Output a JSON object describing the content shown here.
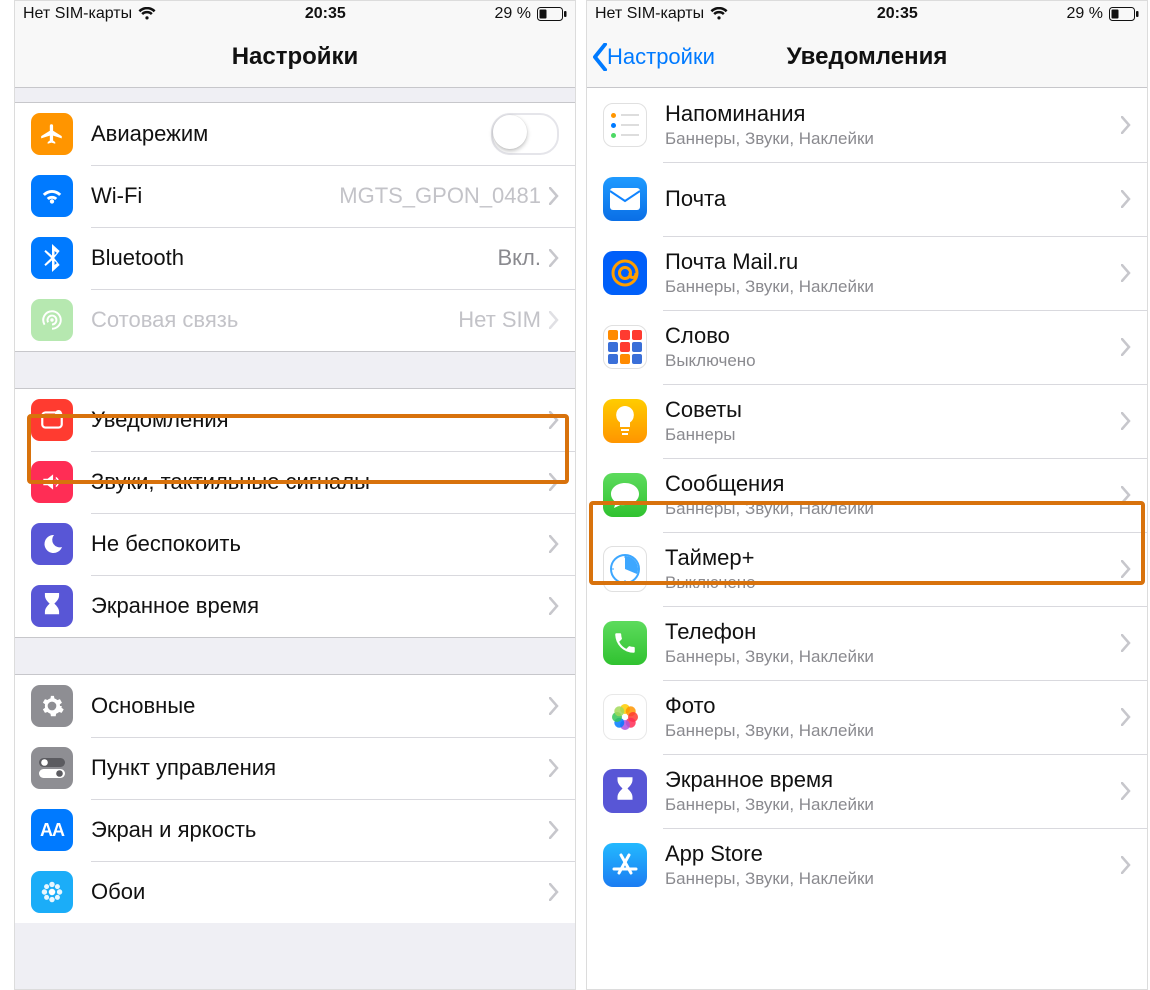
{
  "status": {
    "carrier": "Нет SIM-карты",
    "time": "20:35",
    "battery_pct": "29 %"
  },
  "left": {
    "title": "Настройки",
    "g1": {
      "airplane": "Авиарежим",
      "wifi": "Wi-Fi",
      "wifi_val": "MGTS_GPON_0481",
      "bt": "Bluetooth",
      "bt_val": "Вкл.",
      "cell": "Сотовая связь",
      "cell_val": "Нет SIM"
    },
    "g2": {
      "notif": "Уведомления",
      "sounds": "Звуки, тактильные сигналы",
      "dnd": "Не беспокоить",
      "screentime": "Экранное время"
    },
    "g3": {
      "general": "Основные",
      "control": "Пункт управления",
      "display": "Экран и яркость",
      "wallpaper": "Обои"
    }
  },
  "right": {
    "back": "Настройки",
    "title": "Уведомления",
    "apps": [
      {
        "name": "Напоминания",
        "sub": "Баннеры, Звуки, Наклейки",
        "icon": "reminders"
      },
      {
        "name": "Почта",
        "sub": "",
        "icon": "mail"
      },
      {
        "name": "Почта Mail.ru",
        "sub": "Баннеры, Звуки, Наклейки",
        "icon": "mailru"
      },
      {
        "name": "Слово",
        "sub": "Выключено",
        "icon": "slovo"
      },
      {
        "name": "Советы",
        "sub": "Баннеры",
        "icon": "tips"
      },
      {
        "name": "Сообщения",
        "sub": "Баннеры, Звуки, Наклейки",
        "icon": "messages"
      },
      {
        "name": "Таймер+",
        "sub": "Выключено",
        "icon": "timer"
      },
      {
        "name": "Телефон",
        "sub": "Баннеры, Звуки, Наклейки",
        "icon": "phone"
      },
      {
        "name": "Фото",
        "sub": "Баннеры, Звуки, Наклейки",
        "icon": "photos"
      },
      {
        "name": "Экранное время",
        "sub": "Баннеры, Звуки, Наклейки",
        "icon": "screentime"
      },
      {
        "name": "App Store",
        "sub": "Баннеры, Звуки, Наклейки",
        "icon": "appstore"
      }
    ]
  },
  "colors": {
    "orange": "#ff9500",
    "blue": "#007aff",
    "green": "#4cd964",
    "red": "#ff3b30",
    "pink": "#ff2d55",
    "purple": "#5856d6",
    "gray": "#8e8e93",
    "yellow": "#ffcc00",
    "mailru": "#ff9000",
    "photos": "#f7f7f7",
    "indigo": "#5e5ce6",
    "cyan": "#1badf8"
  }
}
